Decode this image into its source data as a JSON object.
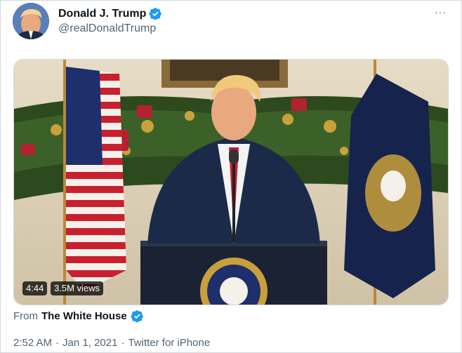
{
  "author": {
    "display_name": "Donald J. Trump",
    "handle": "@realDonaldTrump",
    "verified": true
  },
  "more_icon": "···",
  "media": {
    "duration": "4:44",
    "views": "3.5M views"
  },
  "source": {
    "from_label": "From",
    "name": "The White House",
    "verified": true
  },
  "meta": {
    "time": "2:52 AM",
    "sep1": "·",
    "date": "Jan 1, 2021",
    "sep2": "·",
    "client": "Twitter for iPhone"
  },
  "colors": {
    "verified_blue": "#1d9bf0",
    "secondary_text": "#536471",
    "primary_text": "#0f1419"
  },
  "icons": [
    "avatar-image",
    "verified-badge-icon",
    "more-options-icon",
    "video-thumbnail"
  ]
}
